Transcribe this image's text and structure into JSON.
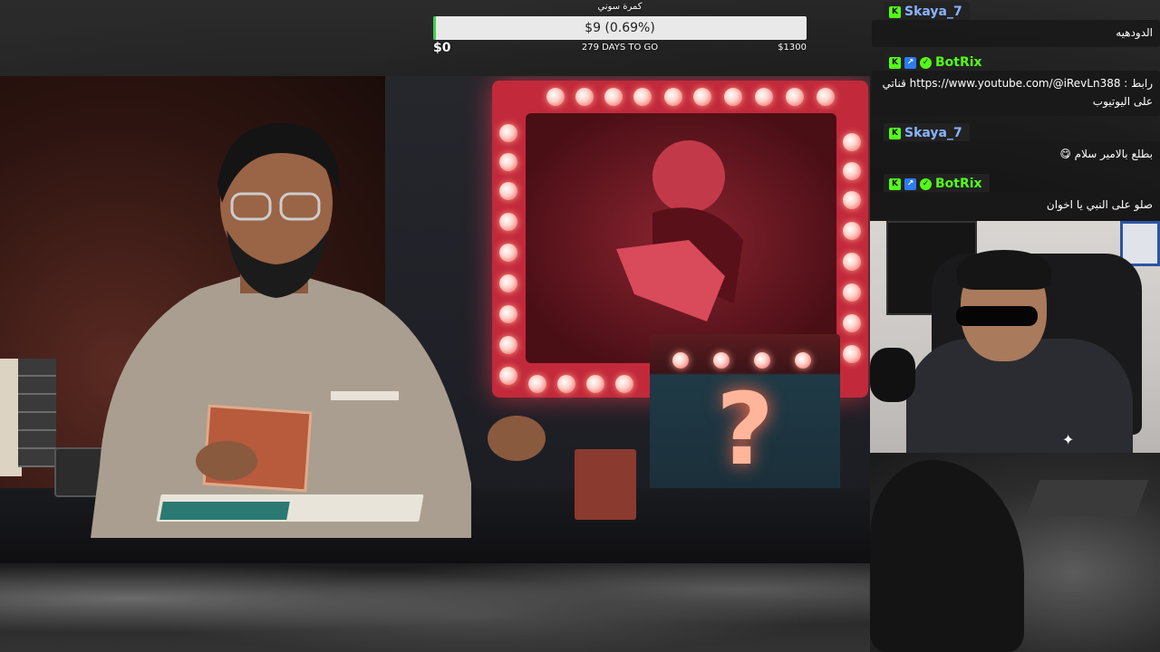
{
  "goal": {
    "title": "كمرة سوني",
    "amount_text": "$9 (0.69%)",
    "progress_percent": 0.69,
    "start_label": "$0",
    "days_left": "279 DAYS TO GO",
    "target_label": "$1300",
    "fill_color": "#3ccf4e"
  },
  "chat": {
    "messages": [
      {
        "username": "Skaya_7",
        "username_color": "#8ab4ff",
        "badges": [
          "kick-badge"
        ],
        "text": "الدودهيه"
      },
      {
        "username": "BotRix",
        "username_color": "#53fc18",
        "badges": [
          "kick-badge",
          "bot-badge",
          "verified-badge"
        ],
        "text": "رابط : https://www.youtube.com/@iRevLn388 قناتي على اليوتيوب"
      },
      {
        "username": "Skaya_7",
        "username_color": "#8ab4ff",
        "badges": [
          "kick-badge"
        ],
        "text": "بطلع بالامير سلام 😋"
      },
      {
        "username": "BotRix",
        "username_color": "#53fc18",
        "badges": [
          "kick-badge",
          "bot-badge",
          "verified-badge"
        ],
        "text": "صلو على النبي يا اخوان"
      }
    ]
  },
  "video": {
    "box_symbol": "?"
  },
  "colors": {
    "kick_green": "#53fc18",
    "marquee_red": "#c2293a"
  }
}
